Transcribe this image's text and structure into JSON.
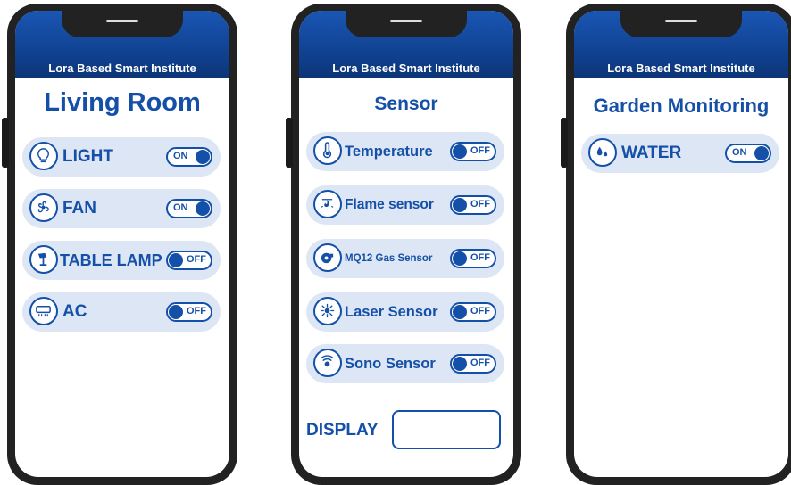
{
  "app_title": "Lora Based Smart Institute",
  "colors": {
    "brand": "#1550a8",
    "header": "#0f3f8c",
    "row_bg": "#dde6f4"
  },
  "phones": [
    {
      "title": "Living Room",
      "rows": [
        {
          "label": "LIGHT",
          "icon": "bulb-icon",
          "state": "ON"
        },
        {
          "label": "FAN",
          "icon": "fan-icon",
          "state": "ON"
        },
        {
          "label": "TABLE LAMP",
          "icon": "lamp-icon",
          "state": "OFF"
        },
        {
          "label": "AC",
          "icon": "ac-icon",
          "state": "OFF"
        }
      ]
    },
    {
      "title": "Sensor",
      "rows": [
        {
          "label": "Temperature",
          "icon": "thermometer-icon",
          "state": "OFF"
        },
        {
          "label": "Flame sensor",
          "icon": "flame-sensor-icon",
          "state": "OFF"
        },
        {
          "label": "MQ12 Gas Sensor",
          "icon": "gas-sensor-icon",
          "state": "OFF"
        },
        {
          "label": "Laser Sensor",
          "icon": "laser-icon",
          "state": "OFF"
        },
        {
          "label": "Sono Sensor",
          "icon": "sonar-icon",
          "state": "OFF"
        }
      ],
      "display_label": "DISPLAY",
      "display_value": ""
    },
    {
      "title": "Garden Monitoring",
      "rows": [
        {
          "label": "WATER",
          "icon": "water-drop-icon",
          "state": "ON"
        }
      ]
    }
  ]
}
